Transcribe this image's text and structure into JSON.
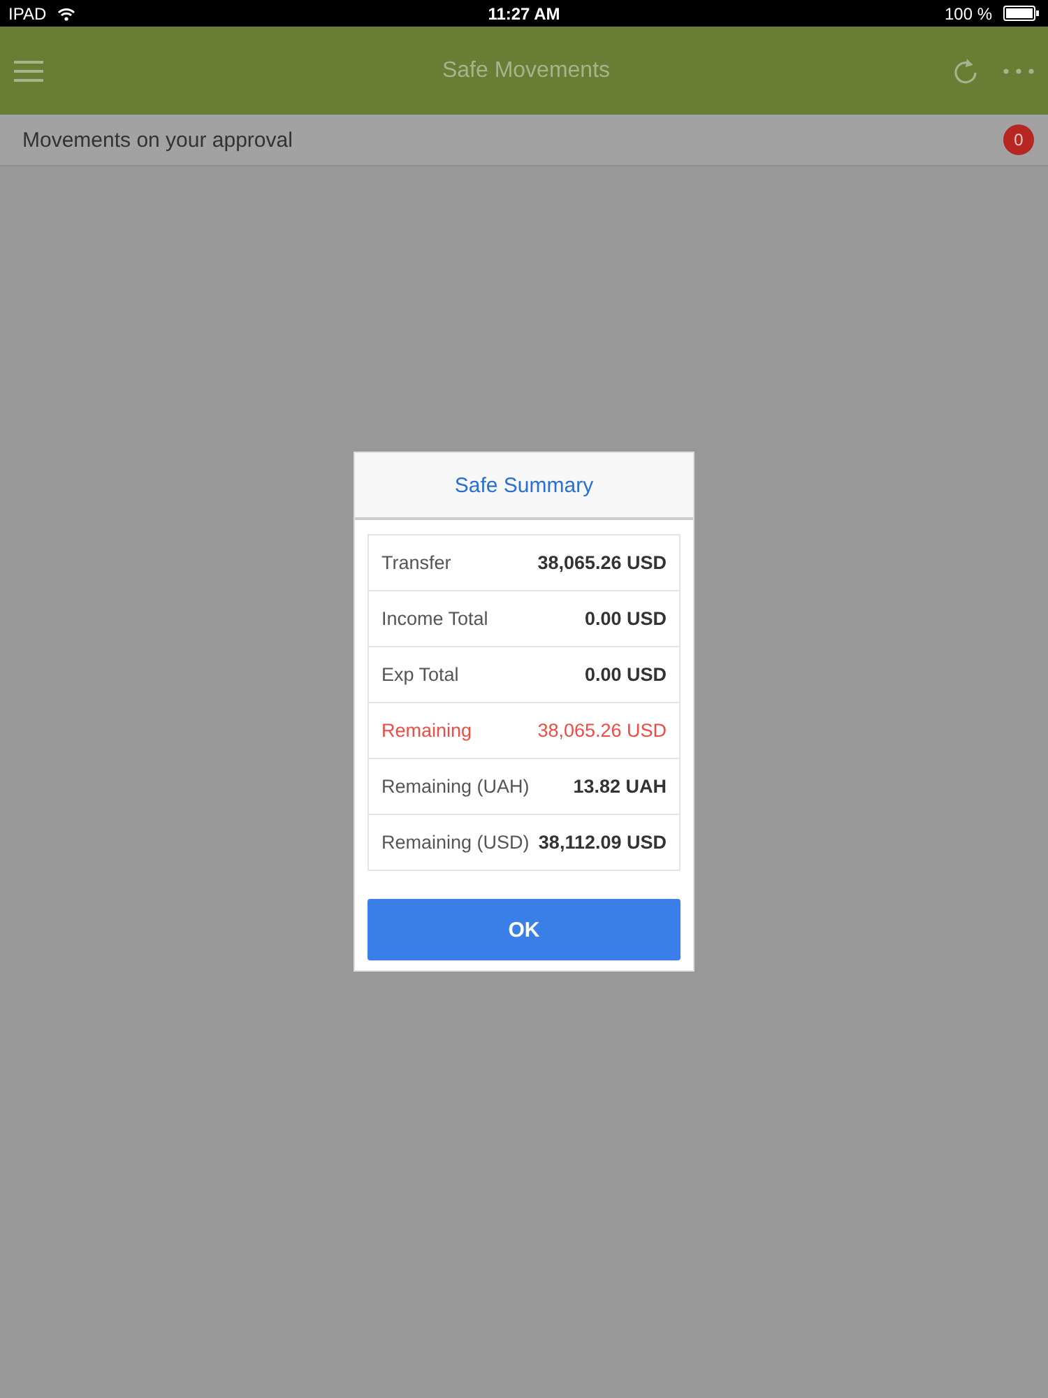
{
  "status_bar": {
    "device": "IPAD",
    "time": "11:27 AM",
    "battery": "100 %"
  },
  "header": {
    "title": "Safe Movements"
  },
  "subheader": {
    "label": "Movements on your approval",
    "badge": "0"
  },
  "dialog": {
    "title": "Safe Summary",
    "rows": [
      {
        "label": "Transfer",
        "value": "38,065.26 USD",
        "highlighted": false
      },
      {
        "label": "Income Total",
        "value": "0.00 USD",
        "highlighted": false
      },
      {
        "label": "Exp Total",
        "value": "0.00 USD",
        "highlighted": false
      },
      {
        "label": "Remaining",
        "value": "38,065.26 USD",
        "highlighted": true
      },
      {
        "label": "Remaining (UAH)",
        "value": "13.82 UAH",
        "highlighted": false
      },
      {
        "label": "Remaining (USD)",
        "value": "38,112.09 USD",
        "highlighted": false
      }
    ],
    "button": "OK"
  }
}
